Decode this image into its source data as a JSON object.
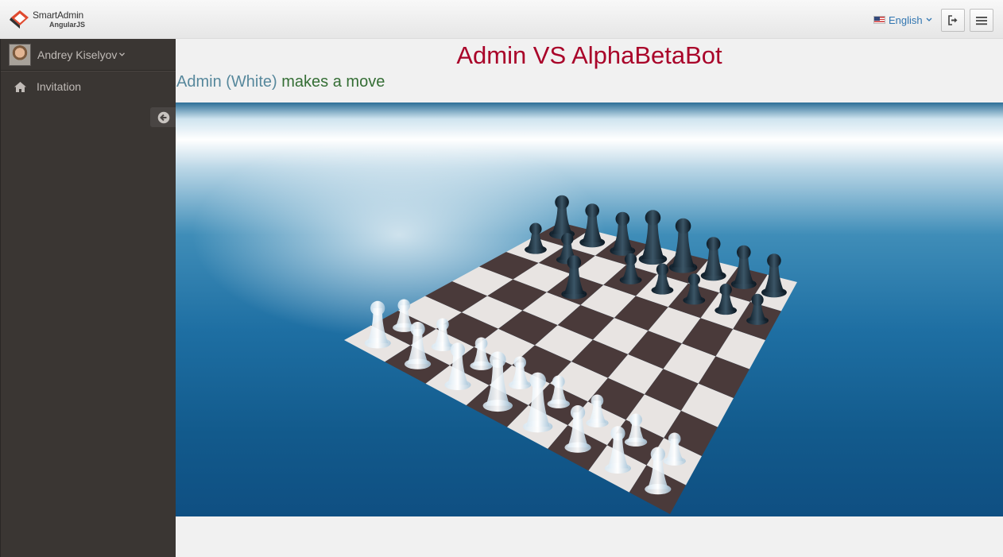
{
  "header": {
    "logo_title": "SmartAdmin",
    "logo_subtitle": "AngularJS",
    "language": "English",
    "logout_icon": "sign-out-icon",
    "menu_icon": "hamburger-icon"
  },
  "sidebar": {
    "user_name": "Andrey Kiselyov",
    "items": [
      {
        "label": "Invitation",
        "icon": "home-icon"
      }
    ],
    "minify_icon": "arrow-circle-left-icon"
  },
  "game": {
    "title": "Admin VS AlphaBetaBot",
    "status_player": "Admin (White)",
    "status_action": "makes a move"
  },
  "colors": {
    "title": "#a90329",
    "player": "#57889c",
    "action": "#356e35",
    "sidebar": "#3a3633",
    "link": "#3276b1"
  }
}
